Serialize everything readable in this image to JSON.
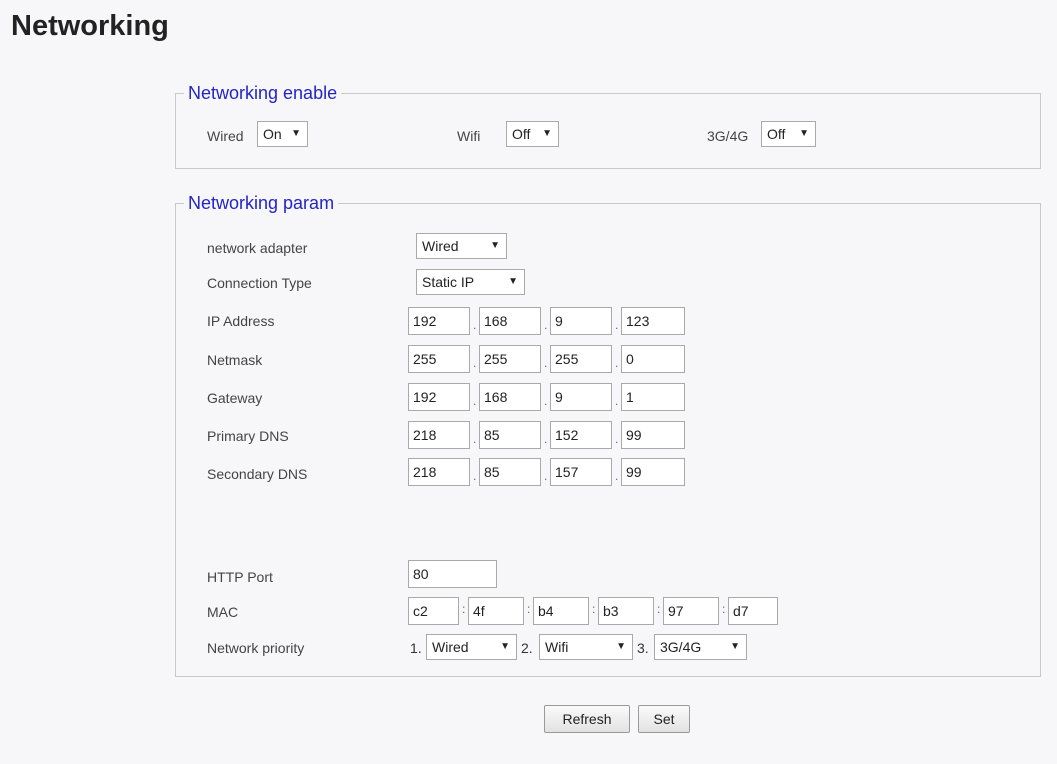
{
  "page_title": "Networking",
  "enable": {
    "legend": "Networking enable",
    "wired": {
      "label": "Wired",
      "value": "On"
    },
    "wifi": {
      "label": "Wifi",
      "value": "Off"
    },
    "cell": {
      "label": "3G/4G",
      "value": "Off"
    }
  },
  "param": {
    "legend": "Networking param",
    "adapter": {
      "label": "network adapter",
      "value": "Wired"
    },
    "conn_type": {
      "label": "Connection Type",
      "value": "Static IP"
    },
    "ip": {
      "label": "IP Address",
      "values": [
        "192",
        "168",
        "9",
        "123"
      ]
    },
    "netmask": {
      "label": "Netmask",
      "values": [
        "255",
        "255",
        "255",
        "0"
      ]
    },
    "gateway": {
      "label": "Gateway",
      "values": [
        "192",
        "168",
        "9",
        "1"
      ]
    },
    "dns1": {
      "label": "Primary DNS",
      "values": [
        "218",
        "85",
        "152",
        "99"
      ]
    },
    "dns2": {
      "label": "Secondary DNS",
      "values": [
        "218",
        "85",
        "157",
        "99"
      ]
    },
    "http_port": {
      "label": "HTTP Port",
      "value": "80"
    },
    "mac": {
      "label": "MAC",
      "values": [
        "c2",
        "4f",
        "b4",
        "b3",
        "97",
        "d7"
      ]
    },
    "priority": {
      "label": "Network priority",
      "items": [
        {
          "num": "1.",
          "value": "Wired"
        },
        {
          "num": "2.",
          "value": "Wifi"
        },
        {
          "num": "3.",
          "value": "3G/4G"
        }
      ]
    }
  },
  "buttons": {
    "refresh": "Refresh",
    "set": "Set"
  },
  "icons": {
    "dropdown": "triangle-down-icon"
  },
  "colors": {
    "legend": "#2323c8",
    "background": "#f7f7f9"
  }
}
